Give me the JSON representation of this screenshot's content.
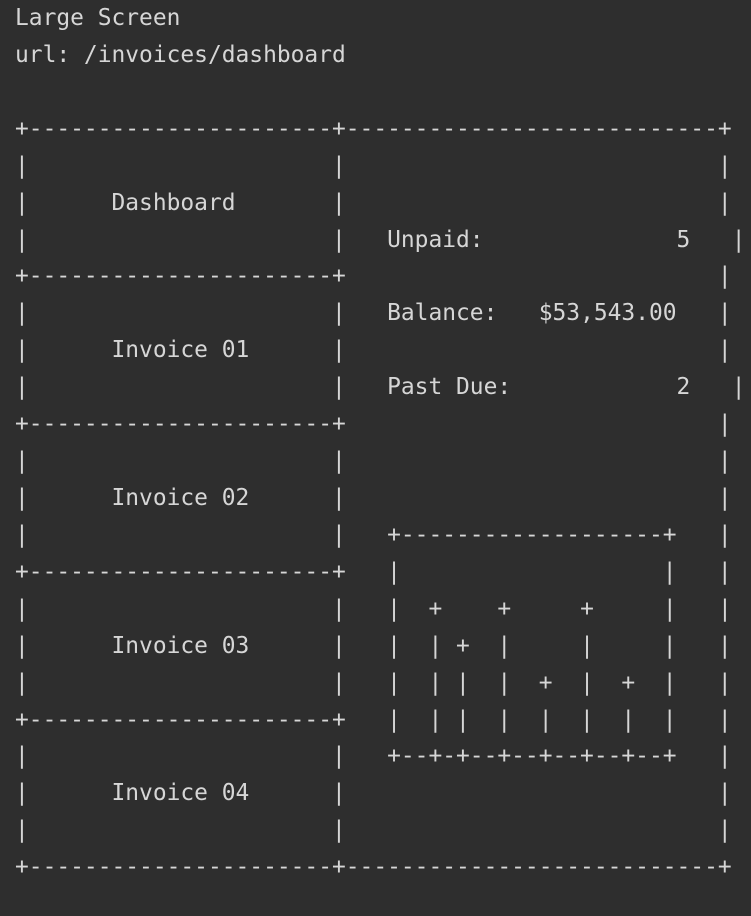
{
  "header": {
    "device": "Large Screen",
    "url_line": "url: /invoices/dashboard"
  },
  "sidebar": {
    "items": [
      {
        "label": "Dashboard"
      },
      {
        "label": "Invoice 01"
      },
      {
        "label": "Invoice 02"
      },
      {
        "label": "Invoice 03"
      },
      {
        "label": "Invoice 04"
      }
    ]
  },
  "summary": {
    "unpaid_label": "Unpaid:",
    "unpaid_value": "5",
    "balance_label": "Balance:",
    "balance_value": "$53,543.00",
    "past_due_label": "Past Due:",
    "past_due_value": "2"
  },
  "chart_data": {
    "type": "bar",
    "categories": [
      "",
      "",
      "",
      "",
      "",
      ""
    ],
    "values": [
      4,
      3,
      4,
      2,
      4,
      2
    ],
    "title": "",
    "xlabel": "",
    "ylabel": "",
    "ylim": [
      0,
      5
    ]
  }
}
